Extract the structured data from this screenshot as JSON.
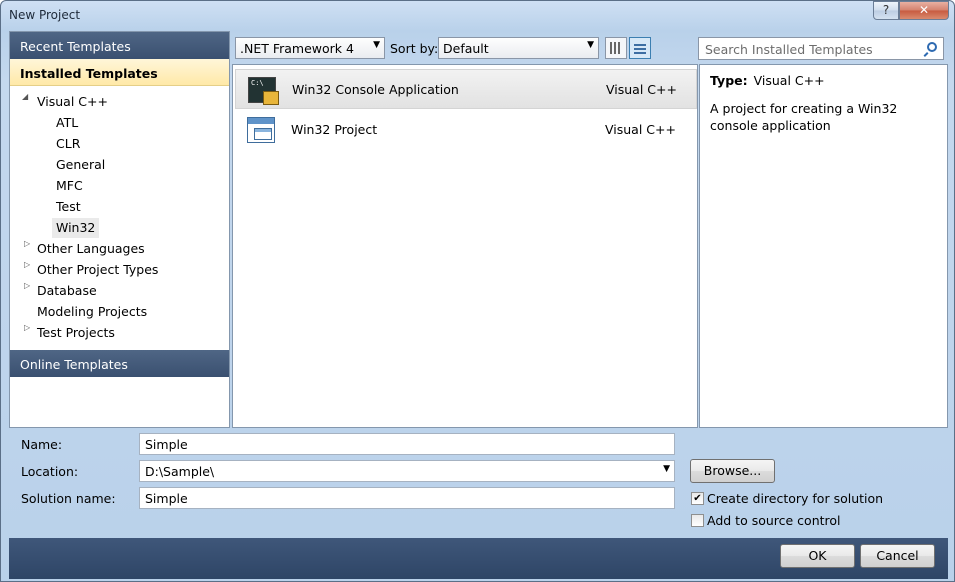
{
  "window": {
    "title": "New Project",
    "help_label": "?",
    "close_label": "✕"
  },
  "left": {
    "recent": "Recent Templates",
    "installed": "Installed Templates",
    "online": "Online Templates",
    "tree": [
      {
        "label": "Visual C++",
        "expanded": true
      },
      {
        "label": "ATL"
      },
      {
        "label": "CLR"
      },
      {
        "label": "General"
      },
      {
        "label": "MFC"
      },
      {
        "label": "Test"
      },
      {
        "label": "Win32",
        "selected": true
      },
      {
        "label": "Other Languages"
      },
      {
        "label": "Other Project Types"
      },
      {
        "label": "Database"
      },
      {
        "label": "Modeling Projects"
      },
      {
        "label": "Test Projects"
      }
    ]
  },
  "toolbar": {
    "framework": ".NET Framework 4",
    "sort_label": "Sort by:",
    "sort_value": "Default",
    "search_placeholder": "Search Installed Templates"
  },
  "templates": [
    {
      "name": "Win32 Console Application",
      "lang": "Visual C++",
      "icon": "console-app-icon",
      "selected": true
    },
    {
      "name": "Win32 Project",
      "lang": "Visual C++",
      "icon": "win32-project-icon"
    }
  ],
  "details": {
    "type_label": "Type:",
    "type_value": "Visual C++",
    "description": "A project for creating a Win32 console application"
  },
  "form": {
    "name_label": "Name:",
    "name_value": "Simple",
    "location_label": "Location:",
    "location_value": "D:\\Sample\\",
    "solution_label": "Solution name:",
    "solution_value": "Simple",
    "browse": "Browse...",
    "create_dir": "Create directory for solution",
    "create_dir_checked": true,
    "source_control": "Add to source control",
    "source_control_checked": false
  },
  "buttons": {
    "ok": "OK",
    "cancel": "Cancel"
  }
}
